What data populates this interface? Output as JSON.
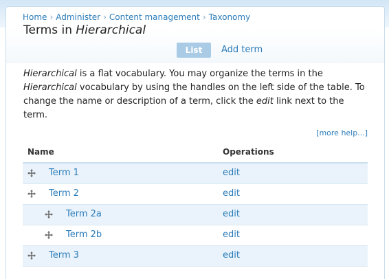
{
  "breadcrumb": [
    "Home",
    "Administer",
    "Content management",
    "Taxonomy"
  ],
  "title": {
    "prefix": "Terms in ",
    "vocabulary": "Hierarchical"
  },
  "tabs": {
    "list": "List",
    "add_term": "Add term"
  },
  "description": {
    "part1_em": "Hierarchical",
    "part2": " is a flat vocabulary. You may organize the terms in the ",
    "part3_em": "Hierarchical",
    "part4": " vocabulary by using the handles on the left side of the table. To change the name or description of a term, click the ",
    "part5_em": "edit",
    "part6": " link next to the term."
  },
  "more_help": "[more help...]",
  "table": {
    "headers": {
      "name": "Name",
      "operations": "Operations"
    },
    "rows": [
      {
        "term": "Term 1",
        "depth": 0,
        "op": "edit"
      },
      {
        "term": "Term 2",
        "depth": 0,
        "op": "edit"
      },
      {
        "term": "Term 2a",
        "depth": 1,
        "op": "edit"
      },
      {
        "term": "Term 2b",
        "depth": 1,
        "op": "edit"
      },
      {
        "term": "Term 3",
        "depth": 0,
        "op": "edit"
      }
    ]
  },
  "colors": {
    "link": "#2b7cb9",
    "active_tab": "#a9cbe6",
    "row_highlight": "#eaf3fb"
  },
  "icons": {
    "drag": "move-cross-icon"
  }
}
